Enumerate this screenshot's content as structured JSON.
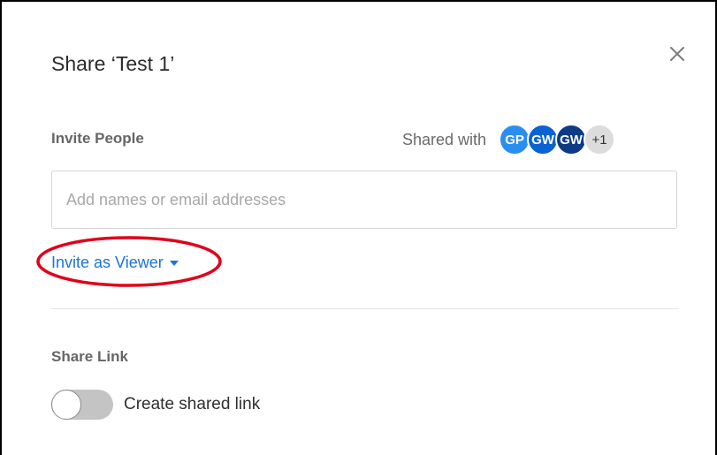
{
  "dialog": {
    "title": "Share ‘Test 1’",
    "close_icon": "close-icon"
  },
  "invite": {
    "label": "Invite People",
    "shared_with_label": "Shared with",
    "avatars": [
      {
        "initials": "GP",
        "color": "#2a8ef0"
      },
      {
        "initials": "GW",
        "color": "#0a63d1"
      },
      {
        "initials": "GW",
        "color": "#0d3b85"
      }
    ],
    "more_count": "+1",
    "input_placeholder": "Add names or email addresses",
    "input_value": "",
    "role_dropdown_label": "Invite as Viewer",
    "role_dropdown_icon": "caret-down-icon"
  },
  "share_link": {
    "label": "Share Link",
    "toggle_label": "Create shared link",
    "toggle_on": false
  },
  "colors": {
    "accent": "#1a73d9",
    "annotation": "#e0001b"
  }
}
